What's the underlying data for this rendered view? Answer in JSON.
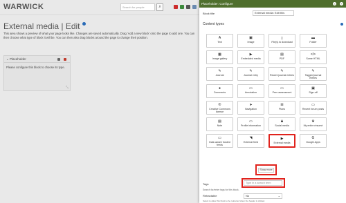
{
  "header": {
    "logo": "WARWICK",
    "search_placeholder": "Search for people",
    "search_icon": "magnifier-icon",
    "flag_colors": [
      "#cc2b2b",
      "#3c8a3c",
      "#555555",
      "#6a8ab0",
      "#3c78b0"
    ]
  },
  "page": {
    "title": "External media | Edit",
    "intro": "This area shows a preview of what your page looks like. Changes are saved automatically. Drag 'Add a new block' onto the page to add one. You can then choose what type of block it will be. You can then also drag blocks around the page to change their position."
  },
  "placeholder_block": {
    "title": "Placeholder",
    "body": "Please configure this block to choose its type."
  },
  "modal": {
    "title": "Placeholder: Configure",
    "block_title_label": "Block title",
    "block_title_value": "External media: Edit this",
    "content_types_label": "Content types",
    "content_types": [
      {
        "label": "Text",
        "icon": "text-icon",
        "glyph": "A"
      },
      {
        "label": "Image",
        "icon": "image-icon",
        "glyph": "▣"
      },
      {
        "label": "File(s) to download",
        "icon": "download-icon",
        "glyph": "⤓"
      },
      {
        "label": "Folder",
        "icon": "folder-icon",
        "glyph": "▬"
      },
      {
        "label": "Image gallery",
        "icon": "gallery-icon",
        "glyph": "▦"
      },
      {
        "label": "Embedded media",
        "icon": "embed-icon",
        "glyph": "▶"
      },
      {
        "label": "PDF",
        "icon": "pdf-icon",
        "glyph": "▤"
      },
      {
        "label": "Some HTML",
        "icon": "code-icon",
        "glyph": "</>"
      },
      {
        "label": "Journal",
        "icon": "journal-icon",
        "glyph": "✎"
      },
      {
        "label": "Journal entry",
        "icon": "journal-entry-icon",
        "glyph": "✎"
      },
      {
        "label": "Recent journal entries",
        "icon": "recent-journal-icon",
        "glyph": "✎"
      },
      {
        "label": "Tagged journal entries",
        "icon": "tagged-journal-icon",
        "glyph": "✎"
      },
      {
        "label": "Comments",
        "icon": "comments-icon",
        "glyph": "●"
      },
      {
        "label": "Annotation",
        "icon": "annotation-icon",
        "glyph": "▭"
      },
      {
        "label": "Peer assessment",
        "icon": "peer-assessment-icon",
        "glyph": "▭"
      },
      {
        "label": "Sign-off",
        "icon": "sign-off-icon",
        "glyph": "▣"
      },
      {
        "label": "Creative Commons license",
        "icon": "creative-commons-icon",
        "glyph": "©"
      },
      {
        "label": "Navigation",
        "icon": "navigation-icon",
        "glyph": "➤"
      },
      {
        "label": "Plans",
        "icon": "plans-icon",
        "glyph": "☰"
      },
      {
        "label": "Recent forum posts",
        "icon": "forum-icon",
        "glyph": "▭"
      },
      {
        "label": "Note",
        "icon": "note-icon",
        "glyph": "▤"
      },
      {
        "label": "Profile information",
        "icon": "profile-icon",
        "glyph": "▭"
      },
      {
        "label": "Social media",
        "icon": "social-media-icon",
        "glyph": "♟"
      },
      {
        "label": "My entire résumé",
        "icon": "resume-icon",
        "glyph": "♛"
      },
      {
        "label": "Date-aware trusted feeds",
        "icon": "trusted-feed-icon",
        "glyph": "▭"
      },
      {
        "label": "External feed",
        "icon": "rss-icon",
        "glyph": "◥"
      },
      {
        "label": "External media",
        "icon": "external-media-icon",
        "glyph": "▶"
      },
      {
        "label": "Google Apps",
        "icon": "google-icon",
        "glyph": "G"
      }
    ],
    "show_more_label": "Show more",
    "tags_label": "Tags",
    "tags_placeholder": "Type in a search term",
    "tags_help": "Search for/enter tags for this block.",
    "retractable_label": "Retractable",
    "retractable_value": "No",
    "retractable_help": "Select to allow this block to be retracted when the header is clicked."
  }
}
